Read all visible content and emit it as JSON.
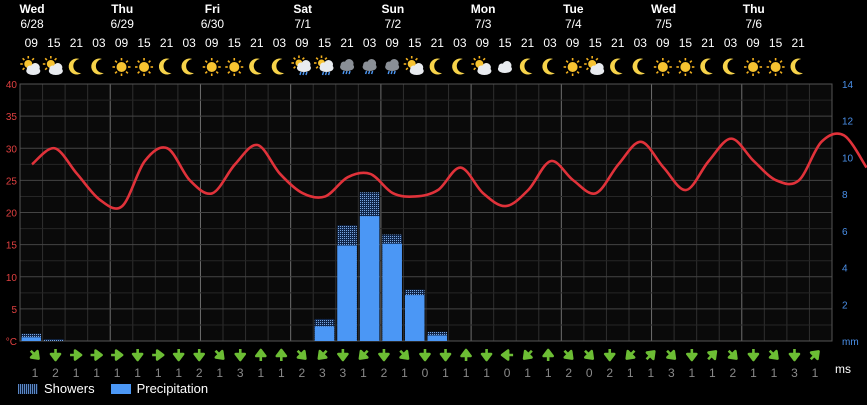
{
  "chart_data": {
    "type": "line",
    "days": [
      {
        "name": "Wed",
        "date": "6/28"
      },
      {
        "name": "Thu",
        "date": "6/29"
      },
      {
        "name": "Fri",
        "date": "6/30"
      },
      {
        "name": "Sat",
        "date": "7/1"
      },
      {
        "name": "Sun",
        "date": "7/2"
      },
      {
        "name": "Mon",
        "date": "7/3"
      },
      {
        "name": "Tue",
        "date": "7/4"
      },
      {
        "name": "Wed",
        "date": "7/5"
      },
      {
        "name": "Thu",
        "date": "7/6"
      }
    ],
    "hours": [
      "09",
      "15",
      "21",
      "03",
      "09",
      "15",
      "21",
      "03",
      "09",
      "15",
      "21",
      "03",
      "09",
      "15",
      "21",
      "03",
      "09",
      "15",
      "21",
      "03",
      "09",
      "15",
      "21",
      "03",
      "09",
      "15",
      "21",
      "03",
      "09",
      "15",
      "21",
      "03",
      "09",
      "15",
      "21"
    ],
    "weather_icons": [
      "sun-cloud",
      "cloud-sun",
      "moon",
      "moon",
      "sun",
      "sun",
      "moon",
      "moon",
      "sun",
      "sun",
      "moon",
      "moon",
      "sun-cloud-rain",
      "cloud-sun-rain",
      "cloud-rain",
      "cloud-rain",
      "cloud-rain",
      "cloud-sun",
      "moon",
      "moon",
      "cloud-sun",
      "cloud",
      "moon",
      "moon",
      "sun",
      "cloud-sun",
      "moon",
      "moon",
      "sun",
      "sun",
      "moon",
      "moon",
      "sun",
      "sun",
      "moon"
    ],
    "temperature": [
      27.5,
      30,
      26,
      22,
      21,
      28,
      30,
      25,
      23,
      27.5,
      30.5,
      26,
      23,
      22.5,
      25.5,
      26,
      23,
      22.5,
      23.5,
      27,
      23,
      21,
      23.5,
      28,
      25,
      23,
      27.5,
      31,
      27,
      23.5,
      28,
      31.5,
      28,
      25,
      25,
      31,
      32,
      27
    ],
    "temperature_unit": "°C",
    "precipitation": [
      0.2,
      0,
      0,
      0,
      0,
      0,
      0,
      0,
      0,
      0,
      0,
      0,
      0,
      0.8,
      5.2,
      6.8,
      5.3,
      2.5,
      0.3,
      0,
      0,
      0,
      0,
      0,
      0,
      0,
      0,
      0,
      0,
      0,
      0,
      0,
      0,
      0,
      0,
      0
    ],
    "showers": [
      0.4,
      0.1,
      0,
      0,
      0,
      0,
      0,
      0,
      0,
      0,
      0,
      0,
      0,
      1.2,
      6.3,
      8.1,
      5.8,
      2.8,
      0.5,
      0,
      0,
      0,
      0,
      0,
      0,
      0,
      0,
      0,
      0,
      0,
      0,
      0,
      0,
      0,
      0,
      0
    ],
    "precip_unit": "mm",
    "wind_speed": [
      1,
      2,
      1,
      1,
      1,
      1,
      1,
      1,
      2,
      1,
      3,
      1,
      1,
      2,
      3,
      3,
      1,
      2,
      1,
      0,
      1,
      1,
      1,
      0,
      1,
      1,
      2,
      0,
      2,
      1,
      1,
      3,
      1,
      1,
      2,
      1,
      1,
      3,
      1
    ],
    "wind_dir": [
      "se",
      "s",
      "e",
      "e",
      "e",
      "s",
      "e",
      "s",
      "s",
      "se",
      "s",
      "n",
      "n",
      "se",
      "sw",
      "s",
      "sw",
      "s",
      "se",
      "s",
      "s",
      "n",
      "s",
      "w",
      "sw",
      "n",
      "se",
      "se",
      "s",
      "sw",
      "ne",
      "se",
      "s",
      "ne",
      "se",
      "s",
      "se",
      "s",
      "ne"
    ],
    "wind_unit": "ms",
    "y_left": {
      "min": 0,
      "max": 40,
      "ticks": [
        40,
        35,
        30,
        25,
        20,
        15,
        10,
        5
      ]
    },
    "y_right": {
      "min": 0,
      "max": 14,
      "ticks": [
        14,
        12,
        10,
        8,
        6,
        4,
        2
      ]
    },
    "legend": [
      {
        "name": "Showers"
      },
      {
        "name": "Precipitation"
      }
    ],
    "colors": {
      "temperature": "#e0323a",
      "precipitation": "#4b97f5",
      "showers": "#5b87c4",
      "wind_arrow": "#6cbd34",
      "grid": "#3a3a3a"
    }
  }
}
